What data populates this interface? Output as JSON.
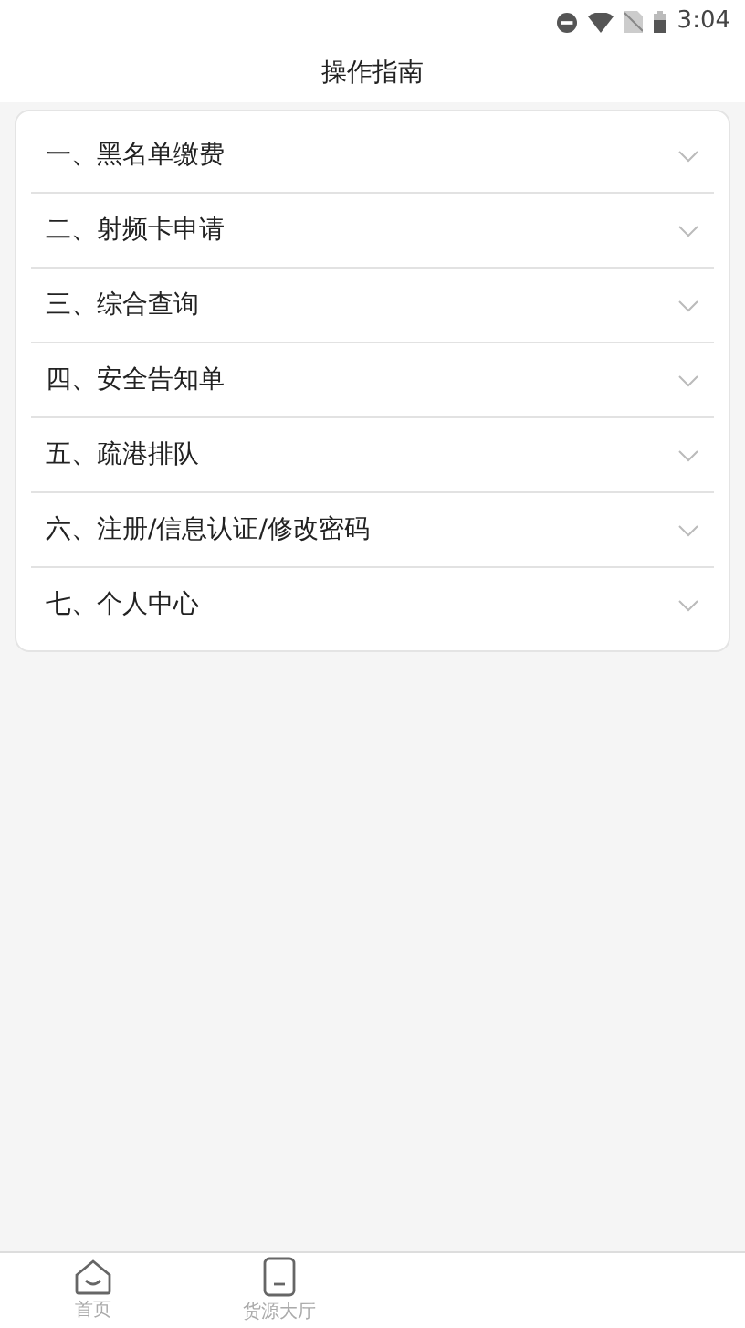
{
  "status_bar": {
    "time": "3:04"
  },
  "header": {
    "title": "操作指南"
  },
  "guide_items": [
    {
      "label": "一、黑名单缴费",
      "expanded": false
    },
    {
      "label": "二、射频卡申请",
      "expanded": false
    },
    {
      "label": "三、综合查询",
      "expanded": false
    },
    {
      "label": "四、安全告知单",
      "expanded": false
    },
    {
      "label": "五、疏港排队",
      "expanded": false
    },
    {
      "label": "六、注册/信息认证/修改密码",
      "expanded": false
    },
    {
      "label": "七、个人中心",
      "expanded": false
    }
  ],
  "bottom_nav": [
    {
      "label": "首页",
      "kind": "home",
      "selected": false
    },
    {
      "label": "货源大厅",
      "kind": "doc",
      "selected": false
    }
  ]
}
